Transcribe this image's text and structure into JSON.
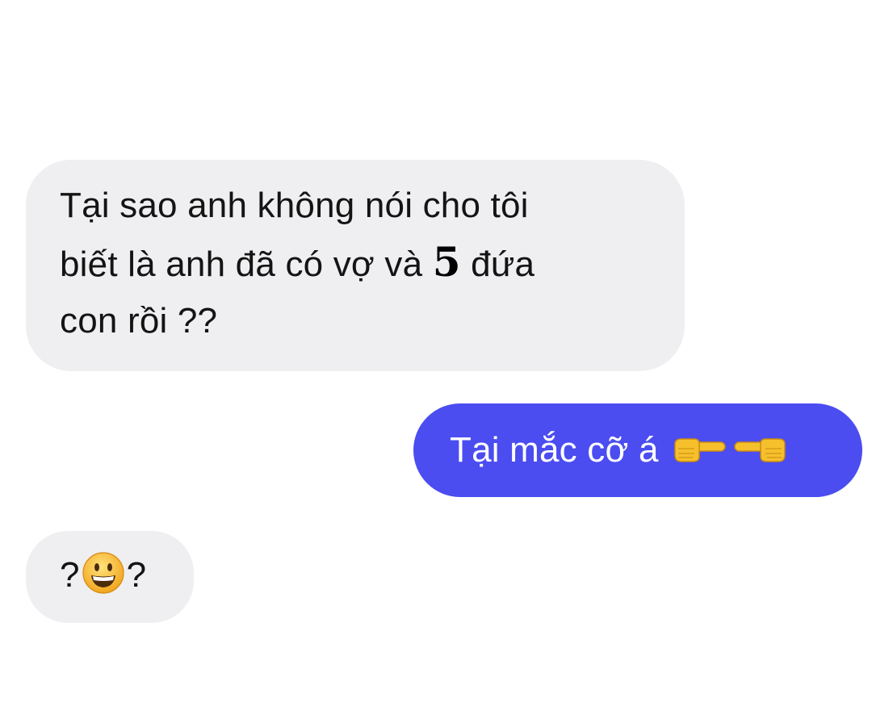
{
  "conversation": {
    "messages": [
      {
        "sender": "incoming",
        "lines": [
          "Tại sao anh không nói cho tôi",
          "biết là anh đã có vợ và",
          "con rồi ??"
        ],
        "bold_number": "5",
        "line2_tail": "đứa"
      },
      {
        "sender": "outgoing",
        "text": "Tại mắc cỡ á",
        "emojis": [
          "pointing-left-hand-icon",
          "pointing-right-hand-icon"
        ]
      },
      {
        "sender": "incoming",
        "prefix": "?",
        "suffix": "?",
        "emoji": "grinning-face-icon"
      }
    ]
  },
  "colors": {
    "incoming_bubble": "#efeff1",
    "outgoing_bubble": "#4b4df0",
    "outgoing_text": "#ffffff",
    "emoji_yellow": "#f5c02c"
  }
}
